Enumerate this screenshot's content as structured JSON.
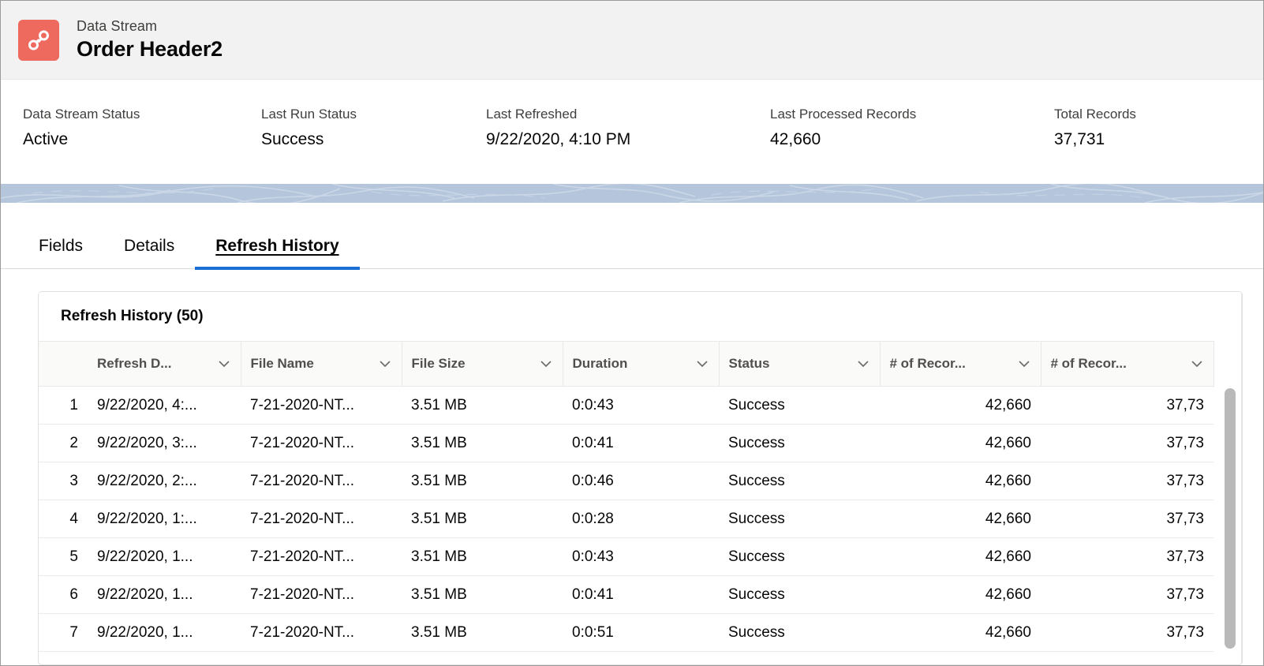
{
  "header": {
    "icon": "data-stream-icon",
    "icon_color": "#ee6a5f",
    "eyebrow": "Data Stream",
    "title": "Order Header2"
  },
  "highlights": [
    {
      "label": "Data Stream Status",
      "value": "Active"
    },
    {
      "label": "Last Run Status",
      "value": "Success"
    },
    {
      "label": "Last Refreshed",
      "value": "9/22/2020, 4:10 PM"
    },
    {
      "label": "Last Processed Records",
      "value": "42,660"
    },
    {
      "label": "Total Records",
      "value": "37,731"
    }
  ],
  "tabs": [
    {
      "label": "Fields",
      "active": false
    },
    {
      "label": "Details",
      "active": false
    },
    {
      "label": "Refresh History",
      "active": true
    }
  ],
  "accent_color": "#1b6fd4",
  "card": {
    "title": "Refresh History (50)",
    "columns": [
      {
        "label": "",
        "key": "idx",
        "sortable": false,
        "align": "right"
      },
      {
        "label": "Refresh D...",
        "key": "date",
        "sortable": true,
        "align": "left"
      },
      {
        "label": "File Name",
        "key": "file",
        "sortable": true,
        "align": "left"
      },
      {
        "label": "File Size",
        "key": "size",
        "sortable": true,
        "align": "left"
      },
      {
        "label": "Duration",
        "key": "dur",
        "sortable": true,
        "align": "left"
      },
      {
        "label": "Status",
        "key": "status",
        "sortable": true,
        "align": "left"
      },
      {
        "label": "# of Recor...",
        "key": "rec1",
        "sortable": true,
        "align": "right"
      },
      {
        "label": "# of Recor...",
        "key": "rec2",
        "sortable": true,
        "align": "right"
      }
    ],
    "rows": [
      {
        "idx": "1",
        "date": "9/22/2020, 4:...",
        "file": "7-21-2020-NT...",
        "size": "3.51 MB",
        "dur": "0:0:43",
        "status": "Success",
        "rec1": "42,660",
        "rec2": "37,73"
      },
      {
        "idx": "2",
        "date": "9/22/2020, 3:...",
        "file": "7-21-2020-NT...",
        "size": "3.51 MB",
        "dur": "0:0:41",
        "status": "Success",
        "rec1": "42,660",
        "rec2": "37,73"
      },
      {
        "idx": "3",
        "date": "9/22/2020, 2:...",
        "file": "7-21-2020-NT...",
        "size": "3.51 MB",
        "dur": "0:0:46",
        "status": "Success",
        "rec1": "42,660",
        "rec2": "37,73"
      },
      {
        "idx": "4",
        "date": "9/22/2020, 1:...",
        "file": "7-21-2020-NT...",
        "size": "3.51 MB",
        "dur": "0:0:28",
        "status": "Success",
        "rec1": "42,660",
        "rec2": "37,73"
      },
      {
        "idx": "5",
        "date": "9/22/2020, 1...",
        "file": "7-21-2020-NT...",
        "size": "3.51 MB",
        "dur": "0:0:43",
        "status": "Success",
        "rec1": "42,660",
        "rec2": "37,73"
      },
      {
        "idx": "6",
        "date": "9/22/2020, 1...",
        "file": "7-21-2020-NT...",
        "size": "3.51 MB",
        "dur": "0:0:41",
        "status": "Success",
        "rec1": "42,660",
        "rec2": "37,73"
      },
      {
        "idx": "7",
        "date": "9/22/2020, 1...",
        "file": "7-21-2020-NT...",
        "size": "3.51 MB",
        "dur": "0:0:51",
        "status": "Success",
        "rec1": "42,660",
        "rec2": "37,73"
      }
    ]
  }
}
